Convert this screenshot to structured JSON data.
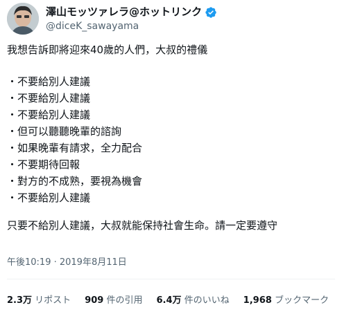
{
  "header": {
    "display_name": "澤山モッツァレラ@ホットリンク",
    "handle": "@diceK_sawayama",
    "verified_color": "#1d9bf0"
  },
  "tweet": {
    "lines": [
      "我想告訴即將迎來40歲的人們，大叔的禮儀",
      "・不要給別人建議",
      "・不要給別人建議",
      "・不要給別人建議",
      "・但可以聽聽晚輩的諮詢",
      "・如果晚輩有請求，全力配合",
      "・不要期待回報",
      "・對方的不成熟，要視為機會",
      "・不要給別人建議",
      "只要不給別人建議，大叔就能保持社會生命。請一定要遵守"
    ],
    "timestamp": "午後10:19 · 2019年8月11日"
  },
  "stats": {
    "retweets_num": "2.3万",
    "retweets_label": "リポスト",
    "quotes_num": "909",
    "quotes_label": "件の引用",
    "likes_num": "6.4万",
    "likes_label": "件のいいね",
    "bookmarks_num": "1,968",
    "bookmarks_label": "ブックマーク"
  }
}
